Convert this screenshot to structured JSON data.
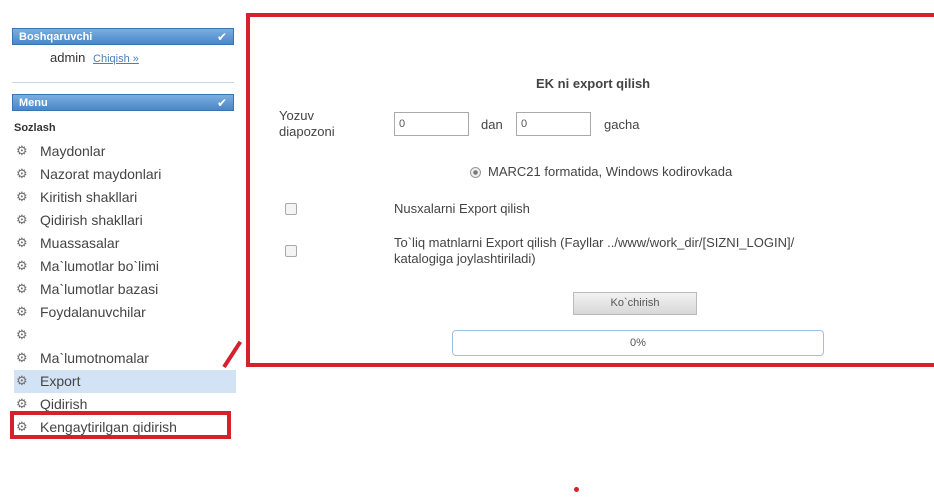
{
  "sidebar": {
    "admin_panel": {
      "title": "Boshqaruvchi",
      "username": "admin",
      "logout_label": "Chiqish »"
    },
    "menu_panel": {
      "title": "Menu"
    },
    "section_title": "Sozlash",
    "items": [
      {
        "label": "Maydonlar"
      },
      {
        "label": "Nazorat maydonlari"
      },
      {
        "label": "Kiritish shakllari"
      },
      {
        "label": "Qidirish shakllari"
      },
      {
        "label": "Muassasalar"
      },
      {
        "label": "Ma`lumotlar bo`limi"
      },
      {
        "label": "Ma`lumotlar bazasi"
      },
      {
        "label": "Foydalanuvchilar"
      },
      {
        "label": ""
      },
      {
        "label": "Ma`lumotnomalar"
      },
      {
        "label": "Export",
        "active": true
      },
      {
        "label": "Qidirish"
      },
      {
        "label": "Kengaytirilgan qidirish"
      }
    ]
  },
  "export_form": {
    "title": "EK ni export qilish",
    "range_label_line1": "Yozuv",
    "range_label_line2": "diapozoni",
    "from_value": "0",
    "from_text": "dan",
    "to_value": "0",
    "to_text": "gacha",
    "format_option": "MARC21 formatida, Windows kodirovkada",
    "export_copies_label": "Nusxalarni Export qilish",
    "fulltext_label_line1": "To`liq matnlarni Export qilish (Fayllar ../www/work_dir/[SIZNI_LOGIN]/",
    "fulltext_label_line2": "katalogiga joylashtiriladi)",
    "copy_button": "Ko`chirish",
    "progress_text": "0%",
    "progress_value": 0
  },
  "colors": {
    "highlight": "#d6202d",
    "panel_header": "#4a87c9",
    "active_item": "#d2e3f5"
  },
  "icons": {
    "menu_item": "gear-icon",
    "panel_check": "check-icon"
  }
}
